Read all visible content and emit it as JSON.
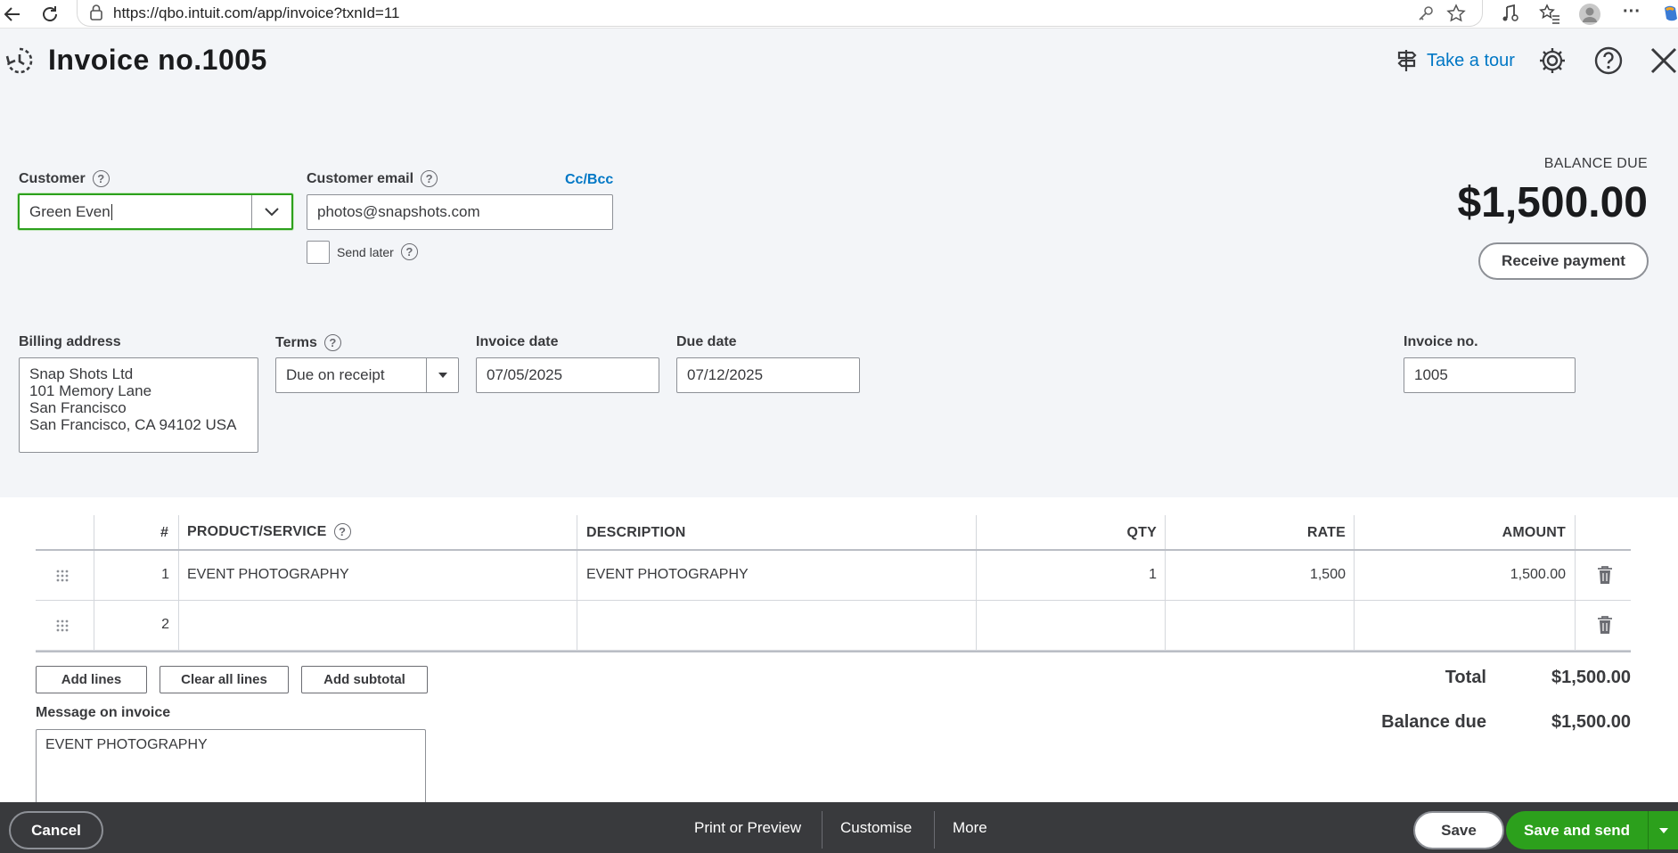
{
  "browser": {
    "url": "https://qbo.intuit.com/app/invoice?txnId=11",
    "more_glyph": "···"
  },
  "header": {
    "title": "Invoice no.1005",
    "take_tour": "Take a tour"
  },
  "customer": {
    "label": "Customer",
    "value": "Green Even",
    "email_label": "Customer email",
    "email_value": "photos@snapshots.com",
    "cc_bcc": "Cc/Bcc",
    "send_later": "Send later"
  },
  "balance": {
    "label": "BALANCE DUE",
    "amount": "$1,500.00",
    "receive_payment": "Receive payment"
  },
  "billing": {
    "label": "Billing address",
    "lines": [
      "Snap Shots Ltd",
      "101 Memory Lane",
      "San Francisco",
      "San Francisco, CA  94102 USA"
    ]
  },
  "terms": {
    "label": "Terms",
    "value": "Due on receipt"
  },
  "invoice_date": {
    "label": "Invoice date",
    "value": "07/05/2025"
  },
  "due_date": {
    "label": "Due date",
    "value": "07/12/2025"
  },
  "invoice_no": {
    "label": "Invoice no.",
    "value": "1005"
  },
  "table": {
    "headers": {
      "num": "#",
      "product": "PRODUCT/SERVICE",
      "description": "DESCRIPTION",
      "qty": "QTY",
      "rate": "RATE",
      "amount": "AMOUNT"
    },
    "rows": [
      {
        "num": "1",
        "product": "EVENT PHOTOGRAPHY",
        "description": "EVENT PHOTOGRAPHY",
        "qty": "1",
        "rate": "1,500",
        "amount": "1,500.00"
      },
      {
        "num": "2",
        "product": "",
        "description": "",
        "qty": "",
        "rate": "",
        "amount": ""
      }
    ]
  },
  "line_buttons": {
    "add_lines": "Add lines",
    "clear_all": "Clear all lines",
    "add_subtotal": "Add subtotal"
  },
  "totals": {
    "total_label": "Total",
    "total_value": "$1,500.00",
    "balance_label": "Balance due",
    "balance_value": "$1,500.00"
  },
  "message": {
    "label": "Message on invoice",
    "value": "EVENT PHOTOGRAPHY"
  },
  "footer": {
    "cancel": "Cancel",
    "print_preview": "Print or Preview",
    "customise": "Customise",
    "more": "More",
    "save": "Save",
    "save_and_send": "Save and send"
  },
  "colors": {
    "accent_green": "#2ca01c",
    "link_blue": "#0077c5",
    "footer_bg": "#393a3d",
    "page_bg": "#f3f5f8"
  }
}
